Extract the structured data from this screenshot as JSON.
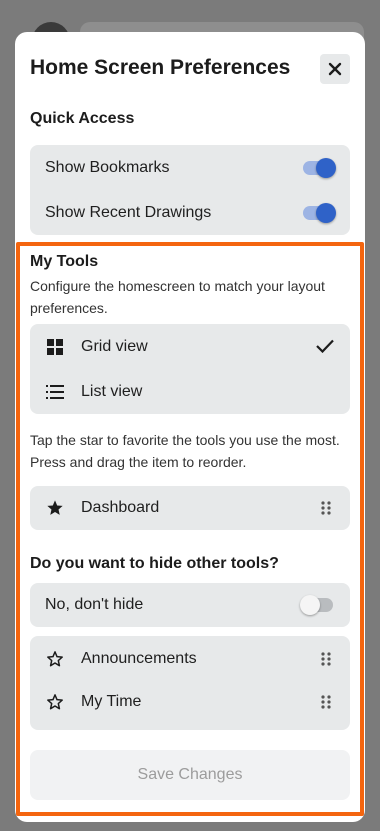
{
  "colors": {
    "accent": "#2f62c8",
    "highlight_border": "#f4650f",
    "group_bg": "#e7e9ea"
  },
  "sheet": {
    "title": "Home Screen Preferences",
    "close_icon": "close-icon"
  },
  "quick_access": {
    "label": "Quick Access",
    "items": [
      {
        "label": "Show Bookmarks",
        "toggle_on": true
      },
      {
        "label": "Show Recent Drawings",
        "toggle_on": true
      }
    ]
  },
  "my_tools": {
    "label": "My Tools",
    "description": "Configure the homescreen to match your layout preferences.",
    "views": [
      {
        "label": "Grid view",
        "icon": "grid-icon",
        "selected": true
      },
      {
        "label": "List view",
        "icon": "list-icon",
        "selected": false
      }
    ],
    "favorite_hint": "Tap the star to favorite the tools you use the most. Press and drag the item to reorder.",
    "favorites": [
      {
        "label": "Dashboard",
        "icon": "star-filled-icon"
      }
    ]
  },
  "hide_tools": {
    "question": "Do you want to hide other tools?",
    "option": {
      "label": "No, don't hide",
      "toggle_on": false
    },
    "tools": [
      {
        "label": "Announcements",
        "icon": "star-outline-icon"
      },
      {
        "label": "My Time",
        "icon": "star-outline-icon"
      }
    ]
  },
  "save_button": {
    "label": "Save Changes",
    "enabled": false
  }
}
